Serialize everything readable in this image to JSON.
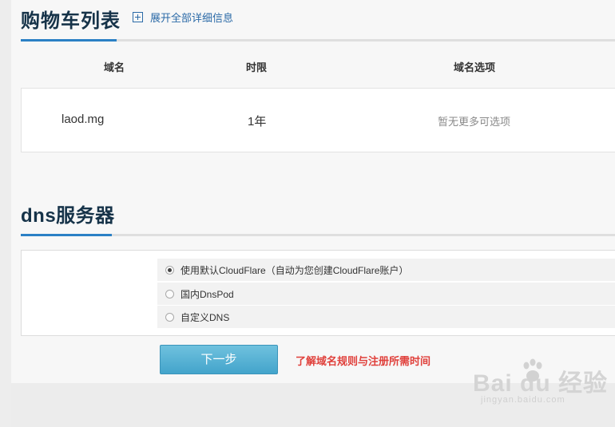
{
  "cart": {
    "title": "购物车列表",
    "expand_link": "展开全部详细信息",
    "columns": [
      "域名",
      "时限",
      "域名选项"
    ],
    "rows": [
      {
        "domain": "laod.mg",
        "period": "1年",
        "options": "暂无更多可选项"
      }
    ]
  },
  "dns": {
    "title": "dns服务器",
    "options": [
      {
        "label": "使用默认CloudFlare（自动为您创建CloudFlare账户）",
        "checked": true
      },
      {
        "label": "国内DnsPod",
        "checked": false
      },
      {
        "label": "自定义DNS",
        "checked": false
      }
    ]
  },
  "actions": {
    "next_label": "下一步",
    "rules_link": "了解域名规则与注册所需时间"
  },
  "watermark": {
    "main": "Bai du 经验",
    "sub": "jingyan.baidu.com"
  },
  "colors": {
    "accent": "#2b80c5",
    "title": "#163349",
    "button": "#4fb0d4",
    "link_red": "#e0403b"
  }
}
